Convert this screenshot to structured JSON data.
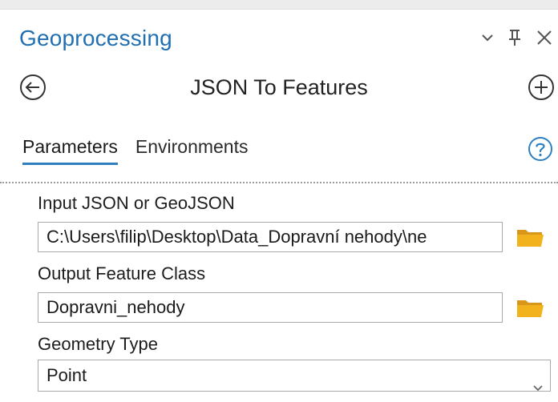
{
  "pane": {
    "title": "Geoprocessing",
    "controls": [
      "chevron-down-icon",
      "pin-icon",
      "close-icon"
    ]
  },
  "tool": {
    "title": "JSON To Features",
    "back_icon": "back-arrow-icon",
    "add_icon": "add-icon"
  },
  "tabs": [
    {
      "label": "Parameters",
      "active": true
    },
    {
      "label": "Environments",
      "active": false
    }
  ],
  "help_icon": "help-icon",
  "params": {
    "input": {
      "label": "Input JSON or GeoJSON",
      "value": "C:\\Users\\filip\\Desktop\\Data_Dopravní nehody\\ne"
    },
    "output": {
      "label": "Output Feature Class",
      "value": "Dopravni_nehody"
    },
    "geometry": {
      "label": "Geometry Type",
      "value": "Point"
    }
  },
  "colors": {
    "accent": "#1f6fb2",
    "tab_underline": "#2f7fc1",
    "folder": "#f2b21e"
  }
}
